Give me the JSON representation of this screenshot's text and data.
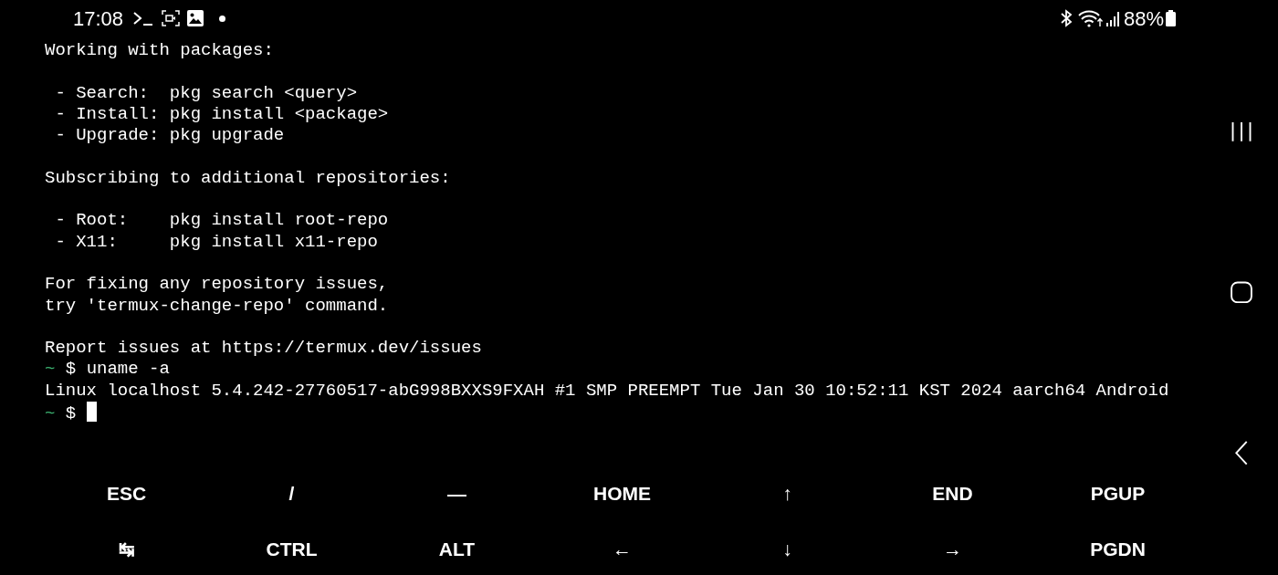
{
  "status_bar": {
    "time": "17:08",
    "battery": "88%"
  },
  "terminal": {
    "lines": [
      {
        "kind": "text",
        "text": "Working with packages:"
      },
      {
        "kind": "blank"
      },
      {
        "kind": "text",
        "text": " - Search:  pkg search <query>"
      },
      {
        "kind": "text",
        "text": " - Install: pkg install <package>"
      },
      {
        "kind": "text",
        "text": " - Upgrade: pkg upgrade"
      },
      {
        "kind": "blank"
      },
      {
        "kind": "text",
        "text": "Subscribing to additional repositories:"
      },
      {
        "kind": "blank"
      },
      {
        "kind": "text",
        "text": " - Root:    pkg install root-repo"
      },
      {
        "kind": "text",
        "text": " - X11:     pkg install x11-repo"
      },
      {
        "kind": "blank"
      },
      {
        "kind": "text",
        "text": "For fixing any repository issues,"
      },
      {
        "kind": "text",
        "text": "try 'termux-change-repo' command."
      },
      {
        "kind": "blank"
      },
      {
        "kind": "text",
        "text": "Report issues at https://termux.dev/issues"
      },
      {
        "kind": "prompt",
        "dir": "~",
        "symbol": "$",
        "command": "uname -a",
        "cursor": false
      },
      {
        "kind": "text",
        "text": "Linux localhost 5.4.242-27760517-abG998BXXS9FXAH #1 SMP PREEMPT Tue Jan 30 10:52:11 KST 2024 aarch64 Android"
      },
      {
        "kind": "prompt",
        "dir": "~",
        "symbol": "$",
        "cursor": true
      }
    ]
  },
  "extra_keys": [
    [
      {
        "label": "ESC"
      },
      {
        "label": "/"
      },
      {
        "label": "—"
      },
      {
        "label": "HOME"
      },
      {
        "label": "↑"
      },
      {
        "label": "END"
      },
      {
        "label": "PGUP"
      }
    ],
    [
      {
        "label": "↹"
      },
      {
        "label": "CTRL"
      },
      {
        "label": "ALT"
      },
      {
        "label": "←"
      },
      {
        "label": "↓"
      },
      {
        "label": "→"
      },
      {
        "label": "PGDN"
      }
    ]
  ]
}
